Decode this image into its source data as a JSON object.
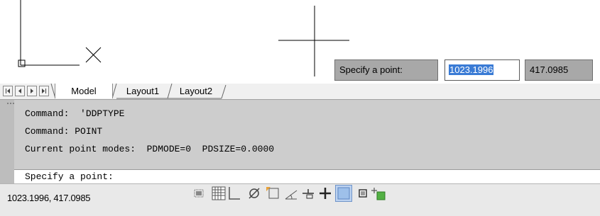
{
  "drawing": {
    "prompt_label": "Specify a point:",
    "coord_x": "1023.1996",
    "coord_y": "417.0985"
  },
  "tabs": [
    {
      "label": "Model",
      "active": true
    },
    {
      "label": "Layout1",
      "active": false
    },
    {
      "label": "Layout2",
      "active": false
    }
  ],
  "nav_icons": [
    "first-tab-icon",
    "previous-tab-icon",
    "next-tab-icon",
    "last-tab-icon"
  ],
  "command_history": [
    "Command:  'DDPTYPE",
    "Command: POINT",
    "Current point modes:  PDMODE=0  PDSIZE=0.0000"
  ],
  "command_prompt": "Specify a point:",
  "status": {
    "coordinates": "1023.1996, 417.0985",
    "toggles": [
      {
        "icon": "infer-constraints-icon",
        "on": false
      },
      {
        "icon": "snap-mode-icon",
        "on": false
      },
      {
        "icon": "grid-display-icon",
        "on": false
      },
      {
        "icon": "ortho-mode-icon",
        "on": false
      },
      {
        "icon": "polar-tracking-icon",
        "on": false
      },
      {
        "icon": "object-snap-icon",
        "on": false
      },
      {
        "icon": "3d-object-snap-icon",
        "on": false
      },
      {
        "icon": "object-snap-tracking-icon",
        "on": false
      },
      {
        "icon": "dynamic-ucs-icon",
        "on": false
      },
      {
        "icon": "dynamic-input-icon",
        "on": false
      },
      {
        "icon": "show-lineweight-icon",
        "on": true
      },
      {
        "icon": "quick-properties-icon",
        "on": false
      },
      {
        "icon": "selection-cycling-icon",
        "on": false
      }
    ]
  },
  "colors": {
    "selection_highlight": "#3a7bd5",
    "command_background": "#c9c9c9",
    "toggle_on": "#bcd2f0"
  }
}
